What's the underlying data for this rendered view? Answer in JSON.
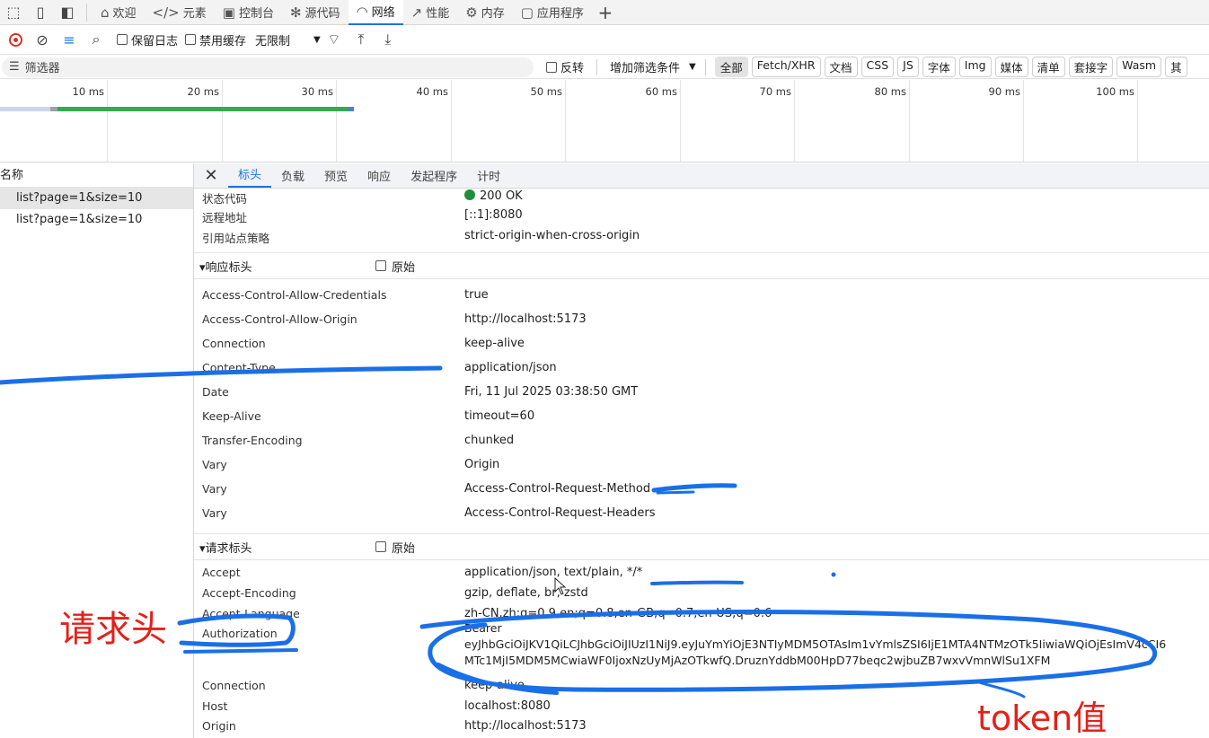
{
  "topbar": {
    "tabs": [
      {
        "label": "欢迎",
        "icon": "home-icon"
      },
      {
        "label": "元素",
        "icon": "code-icon"
      },
      {
        "label": "控制台",
        "icon": "console-icon"
      },
      {
        "label": "源代码",
        "icon": "bug-icon"
      },
      {
        "label": "网络",
        "icon": "wifi-icon"
      },
      {
        "label": "性能",
        "icon": "performance-icon"
      },
      {
        "label": "内存",
        "icon": "memory-icon"
      },
      {
        "label": "应用程序",
        "icon": "application-icon"
      }
    ],
    "add_tab": "+",
    "more": "···",
    "help": "?"
  },
  "toolbar": {
    "preserve_log": "保留日志",
    "disable_cache": "禁用缓存",
    "throttle": "无限制"
  },
  "filterbar": {
    "placeholder": "筛选器",
    "invert": "反转",
    "add_filter": "增加筛选条件",
    "types": [
      "全部",
      "Fetch/XHR",
      "文档",
      "CSS",
      "JS",
      "字体",
      "Img",
      "媒体",
      "清单",
      "套接字",
      "Wasm",
      "其"
    ]
  },
  "timeline": {
    "ticks": [
      "10 ms",
      "20 ms",
      "30 ms",
      "40 ms",
      "50 ms",
      "60 ms",
      "70 ms",
      "80 ms",
      "90 ms",
      "100 ms"
    ]
  },
  "requests": {
    "header": "名称",
    "items": [
      "list?page=1&size=10",
      "list?page=1&size=10"
    ]
  },
  "detail": {
    "tabs": [
      "标头",
      "负载",
      "预览",
      "响应",
      "发起程序",
      "计时"
    ],
    "general": [
      {
        "k": "状态代码",
        "v": "200 OK"
      },
      {
        "k": "远程地址",
        "v": "[::1]:8080"
      },
      {
        "k": "引用站点策略",
        "v": "strict-origin-when-cross-origin"
      }
    ],
    "response_section": "▾响应标头",
    "request_section": "▾请求标头",
    "raw_label": "原始",
    "response_headers": [
      {
        "k": "Access-Control-Allow-Credentials",
        "v": "true"
      },
      {
        "k": "Access-Control-Allow-Origin",
        "v": "http://localhost:5173"
      },
      {
        "k": "Connection",
        "v": "keep-alive"
      },
      {
        "k": "Content-Type",
        "v": "application/json"
      },
      {
        "k": "Date",
        "v": "Fri, 11 Jul 2025 03:38:50 GMT"
      },
      {
        "k": "Keep-Alive",
        "v": "timeout=60"
      },
      {
        "k": "Transfer-Encoding",
        "v": "chunked"
      },
      {
        "k": "Vary",
        "v": "Origin"
      },
      {
        "k": "Vary",
        "v": "Access-Control-Request-Method"
      },
      {
        "k": "Vary",
        "v": "Access-Control-Request-Headers"
      }
    ],
    "request_headers": [
      {
        "k": "Accept",
        "v": "application/json, text/plain, */*"
      },
      {
        "k": "Accept-Encoding",
        "v": "gzip, deflate, br, zstd"
      },
      {
        "k": "Accept-Language",
        "v": "zh-CN,zh;q=0.9,en;q=0.8,en-GB;q=0.7,en-US;q=0.6"
      },
      {
        "k": "Authorization",
        "v1": "Bearer",
        "v2": "eyJhbGciOiJKV1QiLCJhbGciOiJIUzI1NiJ9.eyJuYmYiOjE3NTIyMDM5OTAsIm1vYmlsZSI6IjE1MTA4NTMzOTk5IiwiaWQiOjEsImV4cCI6",
        "v3": "MTc1MjI5MDM5MCwiaWF0IjoxNzUyMjAzOTkwfQ.DruznYddbM00HpD77beqc2wjbuZB7wxvVmnWlSu1XFM"
      },
      {
        "k": "Connection",
        "v": "keep-alive"
      },
      {
        "k": "Host",
        "v": "localhost:8080"
      },
      {
        "k": "Origin",
        "v": "http://localhost:5173"
      }
    ]
  },
  "annotations": {
    "request_header_note": "请求头",
    "token_note": "token值"
  },
  "colors": {
    "accent": "#1a73e8",
    "annotation_red": "#e32119",
    "annotation_blue": "#1a6fe8",
    "status_green": "#1e8e3e"
  }
}
